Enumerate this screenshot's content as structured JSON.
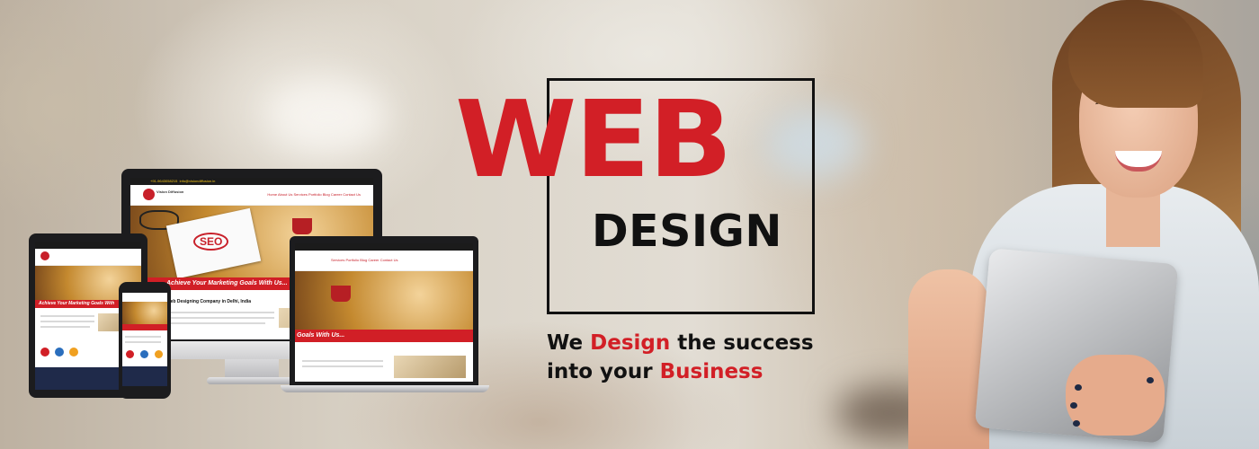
{
  "headline": {
    "word1": "WEB",
    "word2": "DESIGN"
  },
  "tagline": {
    "part1": "We ",
    "highlight1": "Design",
    "part2": " the success",
    "part3": "into your ",
    "highlight2": "Business"
  },
  "mockup": {
    "phone_text": "+91-9643058215",
    "email_text": "info@visiondiffusion.in",
    "logo_text": "Vision Diffusion",
    "menu": "Home   About Us   Services   Portfolio   Blog   Career   Contact Us",
    "banner_text": "Achieve Your Marketing Goals With Us...",
    "seo_text": "SEO",
    "section_heading": "Web Designing Company in Delhi, India"
  },
  "colors": {
    "accent": "#d21f26",
    "text": "#111111"
  }
}
